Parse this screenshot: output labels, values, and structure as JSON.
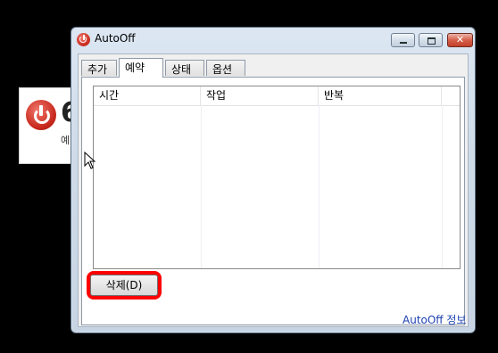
{
  "background_window": {
    "big_text": "6",
    "sub_text": "예"
  },
  "window": {
    "title": "AutoOff",
    "close_glyph": "✕"
  },
  "tabs": [
    {
      "label": "추가",
      "active": false
    },
    {
      "label": "예약",
      "active": true
    },
    {
      "label": "상태",
      "active": false
    },
    {
      "label": "옵션",
      "active": false
    }
  ],
  "table": {
    "columns": [
      "시간",
      "작업",
      "반복"
    ],
    "rows": []
  },
  "delete_button": {
    "label": "삭제(D)"
  },
  "footer_link": "AutoOff 정보",
  "colors": {
    "highlight": "#ff0000",
    "link": "#1b3fb0"
  }
}
